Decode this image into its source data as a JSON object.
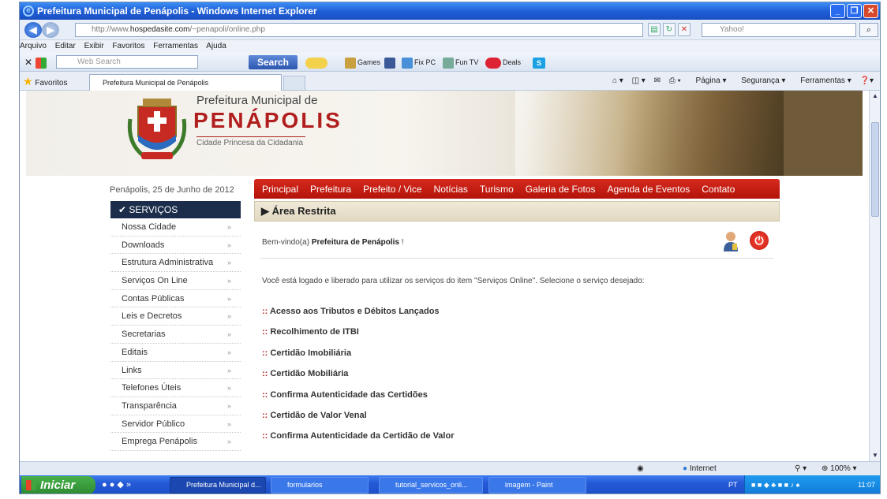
{
  "window": {
    "title": "Prefeitura Municipal de Penápolis - Windows Internet Explorer"
  },
  "address": {
    "url_prefix": "http://www.",
    "url_domain": "hospedasite.com",
    "url_path": "/~penapoli/online.php",
    "search_placeholder": "Yahoo!"
  },
  "menubar": [
    "Arquivo",
    "Editar",
    "Exibir",
    "Favoritos",
    "Ferramentas",
    "Ajuda"
  ],
  "toolbar": {
    "search_placeholder": "Web Search",
    "search_button": "Search",
    "games": "Games",
    "fixpc": "Fix PC",
    "funtv": "Fun TV",
    "deals": "Deals"
  },
  "favbar": {
    "favorites": "Favoritos",
    "tab_title": "Prefeitura Municipal de Penápolis",
    "page": "Página",
    "security": "Segurança",
    "tools": "Ferramentas"
  },
  "site": {
    "logo_pre": "Prefeitura Municipal de",
    "logo_main": "PENÁPOLIS",
    "logo_sub": "Cidade Princesa da Cidadania",
    "date": "Penápolis, 25 de Junho de 2012",
    "nav": [
      "Principal",
      "Prefeitura",
      "Prefeito / Vice",
      "Notícias",
      "Turismo",
      "Galeria de Fotos",
      "Agenda de Eventos",
      "Contato"
    ],
    "sidebar_title": "SERVIÇOS",
    "sidebar": [
      "Nossa Cidade",
      "Downloads",
      "Estrutura Administrativa",
      "Serviços On Line",
      "Contas Públicas",
      "Leis e Decretos",
      "Secretarias",
      "Editais",
      "Links",
      "Telefones Úteis",
      "Transparência",
      "Servidor Público",
      "Emprega Penápolis"
    ],
    "section_title": "Área Restrita",
    "welcome_prefix": "Bem-vindo(a) ",
    "welcome_name": "Prefeitura de Penápolis",
    "welcome_suffix": " !",
    "info": "Você está logado e liberado para utilizar os serviços do item \"Serviços Online\". Selecione o serviço desejado:",
    "links": [
      "Acesso aos Tributos e Débitos Lançados",
      "Recolhimento de ITBI",
      "Certidão Imobiliária",
      "Certidão Mobiliária",
      "Confirma Autenticidade das Certidões",
      "Certidão de Valor Venal",
      "Confirma Autenticidade da Certidão de Valor"
    ],
    "link_prefix": ":: "
  },
  "statusbar": {
    "zone": "Internet",
    "zoom": "100%"
  },
  "taskbar": {
    "start": "Iniciar",
    "tasks": [
      "Prefeitura Municipal d...",
      "formularios",
      "tutorial_servicos_onli...",
      "imagem - Paint"
    ],
    "lang": "PT",
    "time": "11:07"
  },
  "colors": {
    "brand_red": "#b11e1e",
    "nav_red": "#c41e14",
    "sidebar_dark": "#1b2d4a"
  }
}
